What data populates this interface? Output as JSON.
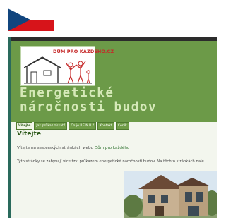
{
  "flag": {
    "name": "czech-flag"
  },
  "logo": {
    "text": "DŮM PRO KAŽDÉHO.CZ"
  },
  "site": {
    "title_line1": "Energetické",
    "title_line2": "náročnosti budov"
  },
  "nav": {
    "items": [
      {
        "label": "Vítejte",
        "active": true
      },
      {
        "label": "Jak průkaz získat?",
        "active": false
      },
      {
        "label": "Co je P.E.N.B.?",
        "active": false
      },
      {
        "label": "Kontakt",
        "active": false
      },
      {
        "label": "Ceník",
        "active": false
      }
    ]
  },
  "page": {
    "heading": "Vítejte",
    "intro_prefix": "Vítejte na sesterských stránkách webu ",
    "intro_link": "Dům pro každého",
    "paragraph2": "Tyto stránky se zabývají více tzv. průkazem energetické náročnosti budov. Na těchto stránkách nale"
  },
  "colors": {
    "header_green": "#6c9a48",
    "title_text": "#d5e9b8",
    "heading_green": "#2f5a1c",
    "frame_dark": "#2c2c2c",
    "accent_teal": "#2a6a5c",
    "logo_red": "#c62a2a"
  }
}
